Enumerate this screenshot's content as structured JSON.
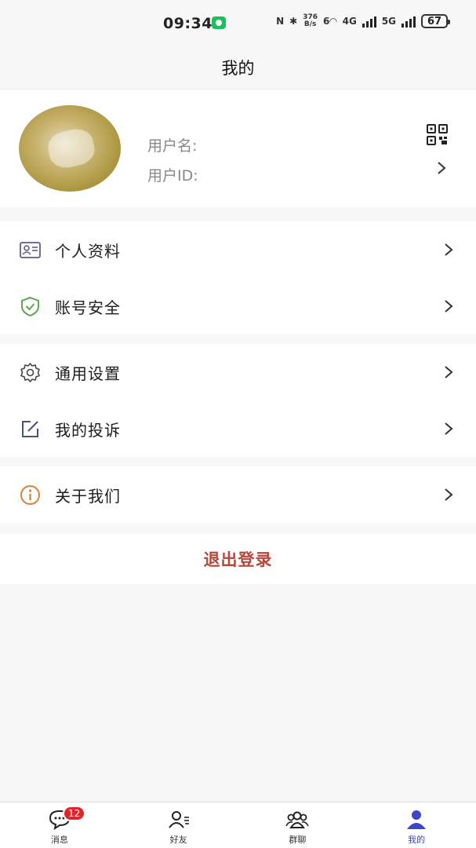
{
  "status_bar": {
    "time": "09:34",
    "net_speed_value": "376",
    "net_speed_unit": "B/s",
    "wifi_label": "6",
    "signal1_label": "4G",
    "signal2_label": "5G",
    "battery": "67"
  },
  "header": {
    "title": "我的"
  },
  "profile": {
    "username_label": "用户名:",
    "userid_label": "用户ID:"
  },
  "menu": {
    "items": [
      {
        "label": "个人资料",
        "icon": "id-card-icon"
      },
      {
        "label": "账号安全",
        "icon": "shield-check-icon"
      },
      {
        "label": "通用设置",
        "icon": "gear-icon"
      },
      {
        "label": "我的投诉",
        "icon": "edit-square-icon"
      },
      {
        "label": "关于我们",
        "icon": "info-icon"
      }
    ]
  },
  "logout": {
    "label": "退出登录"
  },
  "bottom_nav": {
    "items": [
      {
        "label": "消息",
        "icon": "chat-bubble-icon",
        "badge": "12"
      },
      {
        "label": "好友",
        "icon": "friends-icon"
      },
      {
        "label": "群聊",
        "icon": "group-icon"
      },
      {
        "label": "我的",
        "icon": "person-icon",
        "active": true
      }
    ]
  },
  "colors": {
    "accent": "#3d46c9",
    "logout": "#b8463a",
    "badge": "#e2252a",
    "security_icon": "#5aa84a",
    "about_icon": "#d9823a"
  }
}
